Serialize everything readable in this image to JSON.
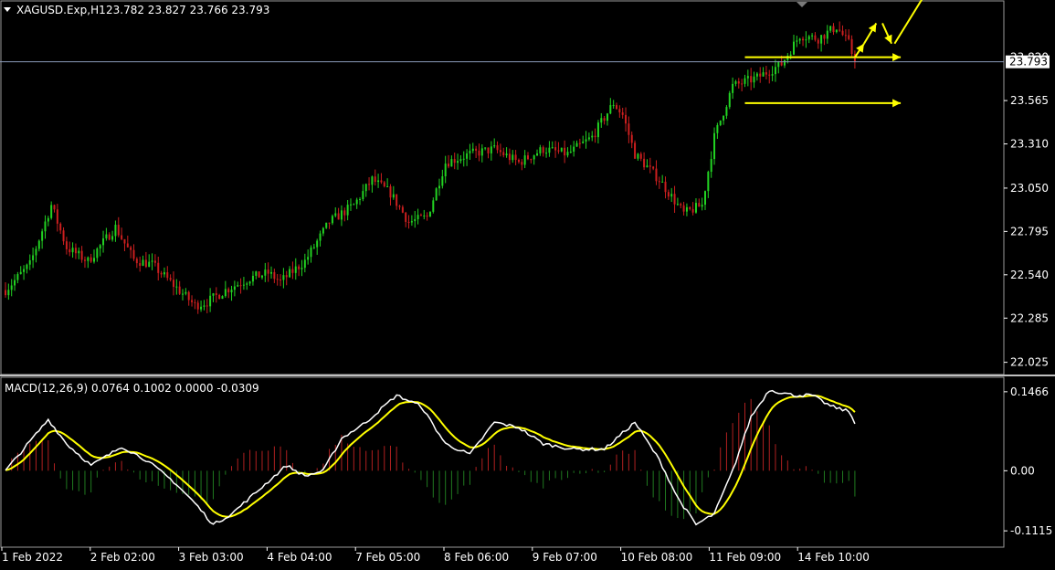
{
  "header": {
    "symbol": "XAGUSD.Exp,H1",
    "ohlc": "23.782 23.827 23.766 23.793"
  },
  "price_axis": {
    "ticks": [
      "23.565",
      "23.310",
      "23.050",
      "22.795",
      "22.540",
      "22.285",
      "22.025"
    ],
    "tick_values": [
      23.565,
      23.31,
      23.05,
      22.795,
      22.54,
      22.285,
      22.025
    ],
    "current_price_label": "23.793",
    "current_price": 23.793,
    "partial_top_label": "23.820",
    "range": [
      21.98,
      24.06
    ]
  },
  "macd_panel": {
    "title": "MACD(12,26,9) 0.0764 0.1002 0.0000 -0.0309",
    "ticks": [
      "0.1466",
      "0.00",
      "-0.1115"
    ],
    "tick_values": [
      0.1466,
      0.0,
      -0.1115
    ],
    "range": [
      -0.135,
      0.165
    ]
  },
  "time_axis": {
    "labels": [
      "1 Feb 2022",
      "2 Feb 02:00",
      "3 Feb 03:00",
      "4 Feb 04:00",
      "7 Feb 05:00",
      "8 Feb 06:00",
      "9 Feb 07:00",
      "10 Feb 08:00",
      "11 Feb 09:00",
      "14 Feb 10:00"
    ]
  },
  "colors": {
    "background": "#000000",
    "bull_candle": "#22d322",
    "bear_candle": "#cc1f1f",
    "grid_text": "#ffffff",
    "macd_line": "#ffffff",
    "signal_line": "#ffff00",
    "hist_positive": "#b02020",
    "hist_negative": "#207a20",
    "annotation": "#ffff00",
    "separator": "#a0a0a0"
  },
  "chart_data": [
    {
      "type": "candlestick",
      "title": "XAGUSD.Exp,H1",
      "timeframe": "H1",
      "y_range": [
        21.98,
        24.06
      ],
      "close_path_anchors": [
        {
          "bar": 0,
          "price": 22.45
        },
        {
          "bar": 8,
          "price": 22.6
        },
        {
          "bar": 15,
          "price": 22.95
        },
        {
          "bar": 20,
          "price": 22.7
        },
        {
          "bar": 27,
          "price": 22.62
        },
        {
          "bar": 36,
          "price": 22.82
        },
        {
          "bar": 42,
          "price": 22.63
        },
        {
          "bar": 48,
          "price": 22.6
        },
        {
          "bar": 55,
          "price": 22.48
        },
        {
          "bar": 62,
          "price": 22.36
        },
        {
          "bar": 66,
          "price": 22.38
        },
        {
          "bar": 72,
          "price": 22.45
        },
        {
          "bar": 80,
          "price": 22.52
        },
        {
          "bar": 86,
          "price": 22.55
        },
        {
          "bar": 90,
          "price": 22.5
        },
        {
          "bar": 98,
          "price": 22.62
        },
        {
          "bar": 106,
          "price": 22.85
        },
        {
          "bar": 114,
          "price": 22.95
        },
        {
          "bar": 120,
          "price": 23.1
        },
        {
          "bar": 126,
          "price": 23.02
        },
        {
          "bar": 132,
          "price": 22.85
        },
        {
          "bar": 138,
          "price": 22.88
        },
        {
          "bar": 144,
          "price": 23.2
        },
        {
          "bar": 152,
          "price": 23.25
        },
        {
          "bar": 160,
          "price": 23.28
        },
        {
          "bar": 168,
          "price": 23.2
        },
        {
          "bar": 176,
          "price": 23.28
        },
        {
          "bar": 184,
          "price": 23.25
        },
        {
          "bar": 192,
          "price": 23.35
        },
        {
          "bar": 199,
          "price": 23.55
        },
        {
          "bar": 202,
          "price": 23.48
        },
        {
          "bar": 206,
          "price": 23.25
        },
        {
          "bar": 214,
          "price": 23.1
        },
        {
          "bar": 222,
          "price": 22.9
        },
        {
          "bar": 228,
          "price": 22.95
        },
        {
          "bar": 232,
          "price": 23.35
        },
        {
          "bar": 238,
          "price": 23.65
        },
        {
          "bar": 246,
          "price": 23.7
        },
        {
          "bar": 254,
          "price": 23.78
        },
        {
          "bar": 260,
          "price": 23.95
        },
        {
          "bar": 266,
          "price": 23.93
        },
        {
          "bar": 272,
          "price": 24.0
        },
        {
          "bar": 276,
          "price": 23.9
        },
        {
          "bar": 278,
          "price": 23.793
        }
      ],
      "bars": 279,
      "last_close": 23.793
    },
    {
      "type": "macd",
      "title": "MACD(12,26,9)",
      "params": [
        12,
        26,
        9
      ],
      "values": {
        "main": 0.0764,
        "signal": 0.1002,
        "third": 0.0,
        "fourth": -0.0309
      },
      "y_range": [
        -0.1115,
        0.1466
      ],
      "macd_anchors": [
        {
          "bar": 0,
          "v": 0.0
        },
        {
          "bar": 14,
          "v": 0.095
        },
        {
          "bar": 20,
          "v": 0.05
        },
        {
          "bar": 28,
          "v": 0.01
        },
        {
          "bar": 34,
          "v": 0.03
        },
        {
          "bar": 38,
          "v": 0.045
        },
        {
          "bar": 46,
          "v": 0.02
        },
        {
          "bar": 55,
          "v": -0.02
        },
        {
          "bar": 62,
          "v": -0.06
        },
        {
          "bar": 68,
          "v": -0.1
        },
        {
          "bar": 74,
          "v": -0.08
        },
        {
          "bar": 82,
          "v": -0.04
        },
        {
          "bar": 92,
          "v": 0.01
        },
        {
          "bar": 98,
          "v": -0.01
        },
        {
          "bar": 104,
          "v": 0.0
        },
        {
          "bar": 110,
          "v": 0.06
        },
        {
          "bar": 118,
          "v": 0.09
        },
        {
          "bar": 128,
          "v": 0.14
        },
        {
          "bar": 136,
          "v": 0.12
        },
        {
          "bar": 144,
          "v": 0.05
        },
        {
          "bar": 152,
          "v": 0.03
        },
        {
          "bar": 160,
          "v": 0.09
        },
        {
          "bar": 168,
          "v": 0.08
        },
        {
          "bar": 176,
          "v": 0.05
        },
        {
          "bar": 186,
          "v": 0.04
        },
        {
          "bar": 196,
          "v": 0.04
        },
        {
          "bar": 206,
          "v": 0.09
        },
        {
          "bar": 214,
          "v": 0.02
        },
        {
          "bar": 220,
          "v": -0.05
        },
        {
          "bar": 226,
          "v": -0.1
        },
        {
          "bar": 232,
          "v": -0.08
        },
        {
          "bar": 238,
          "v": 0.0
        },
        {
          "bar": 244,
          "v": 0.1
        },
        {
          "bar": 250,
          "v": 0.15
        },
        {
          "bar": 258,
          "v": 0.14
        },
        {
          "bar": 264,
          "v": 0.14
        },
        {
          "bar": 270,
          "v": 0.12
        },
        {
          "bar": 276,
          "v": 0.11
        },
        {
          "bar": 278,
          "v": 0.09
        }
      ]
    }
  ],
  "annotations": {
    "arrows": [
      {
        "from": {
          "bar": 242,
          "price": 23.82
        },
        "to": {
          "bar": 293,
          "price": 23.82
        }
      },
      {
        "from": {
          "bar": 242,
          "price": 23.55
        },
        "to": {
          "bar": 293,
          "price": 23.55
        }
      },
      {
        "from": {
          "bar": 278,
          "price": 23.82
        },
        "to": {
          "bar": 281,
          "price": 23.9
        }
      },
      {
        "from": {
          "bar": 281,
          "price": 23.9
        },
        "to": {
          "bar": 285,
          "price": 24.02
        }
      },
      {
        "from": {
          "bar": 287,
          "price": 24.02
        },
        "to": {
          "bar": 290,
          "price": 23.9
        }
      },
      {
        "from": {
          "bar": 291,
          "price": 23.9
        },
        "to": {
          "bar": 303,
          "price": 24.25
        }
      }
    ]
  }
}
